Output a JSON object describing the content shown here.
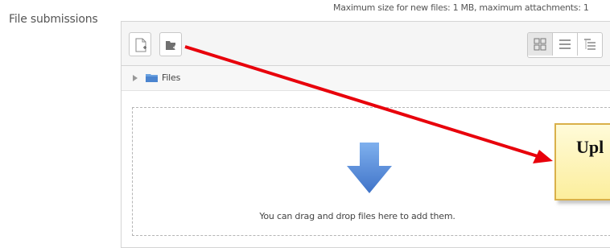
{
  "field": {
    "label": "File submissions"
  },
  "limits": {
    "text": "Maximum size for new files: 1 MB, maximum attachments: 1"
  },
  "toolbar": {
    "add_file_icon": "add-file-icon",
    "create_folder_icon": "create-folder-icon",
    "views": [
      "icons-view",
      "list-view",
      "tree-view"
    ]
  },
  "path": {
    "label": "Files"
  },
  "dropzone": {
    "text": "You can drag and drop files here to add them."
  },
  "callout": {
    "text": "Upl"
  },
  "colors": {
    "arrow": "#e8000b",
    "callout_bg": "#fcee9c",
    "callout_border": "#d9b04a",
    "drop_arrow": "#4e86d9"
  }
}
